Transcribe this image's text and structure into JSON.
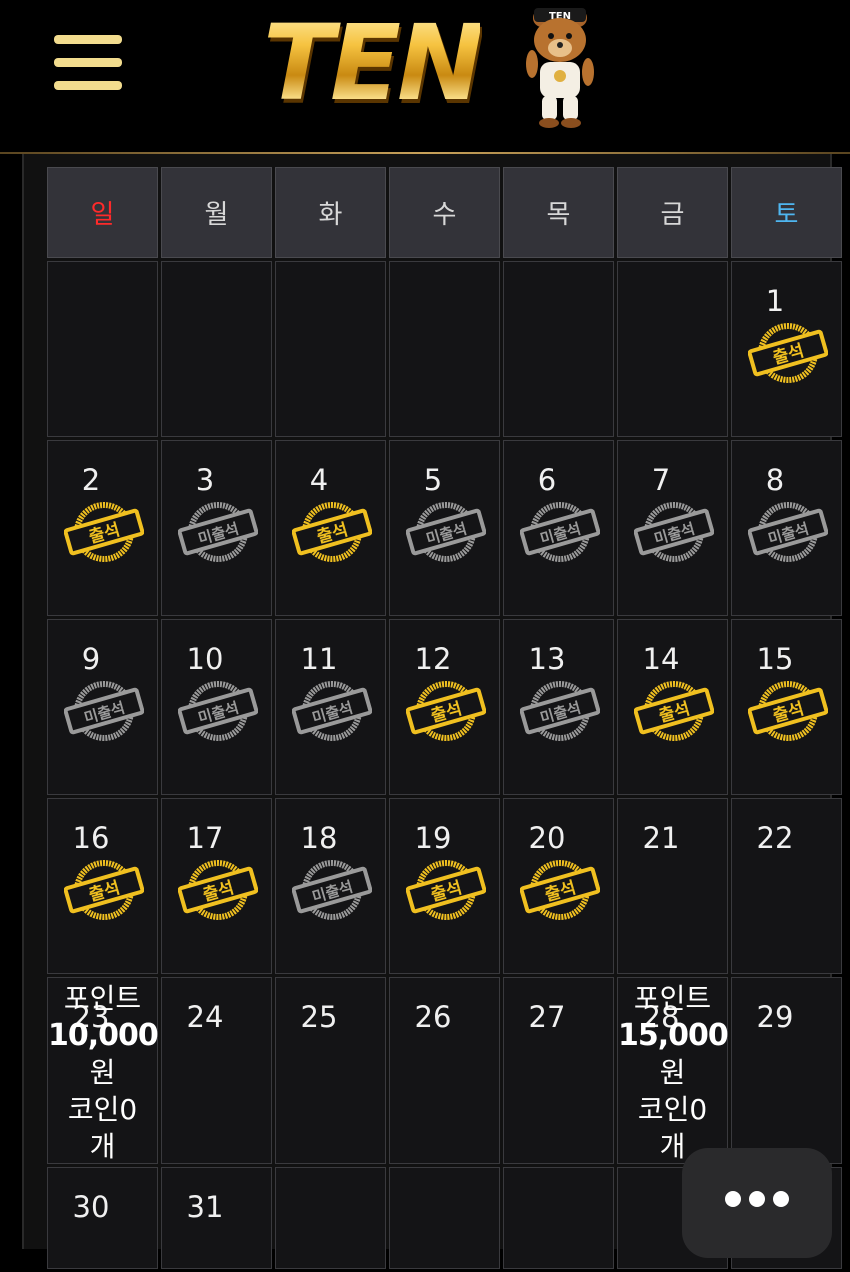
{
  "header": {
    "menu_icon": "hamburger-menu-icon",
    "logo_text": "TEN",
    "mascot_badge": "TEN"
  },
  "calendar": {
    "weekdays": [
      "일",
      "월",
      "화",
      "수",
      "목",
      "금",
      "토"
    ],
    "colors": {
      "sunday": "#ff2a2a",
      "saturday": "#4fb6f0",
      "attended": "#f0c020",
      "absent": "#9a9a9a"
    },
    "stamp_attended_label": "출석",
    "stamp_absent_label": "미출석",
    "weeks": [
      [
        null,
        null,
        null,
        null,
        null,
        null,
        {
          "day": "1",
          "stamp": "attended"
        }
      ],
      [
        {
          "day": "2",
          "stamp": "attended"
        },
        {
          "day": "3",
          "stamp": "absent"
        },
        {
          "day": "4",
          "stamp": "attended"
        },
        {
          "day": "5",
          "stamp": "absent"
        },
        {
          "day": "6",
          "stamp": "absent"
        },
        {
          "day": "7",
          "stamp": "absent"
        },
        {
          "day": "8",
          "stamp": "absent"
        }
      ],
      [
        {
          "day": "9",
          "stamp": "absent"
        },
        {
          "day": "10",
          "stamp": "absent"
        },
        {
          "day": "11",
          "stamp": "absent"
        },
        {
          "day": "12",
          "stamp": "attended"
        },
        {
          "day": "13",
          "stamp": "absent"
        },
        {
          "day": "14",
          "stamp": "attended"
        },
        {
          "day": "15",
          "stamp": "attended"
        }
      ],
      [
        {
          "day": "16",
          "stamp": "attended"
        },
        {
          "day": "17",
          "stamp": "attended"
        },
        {
          "day": "18",
          "stamp": "absent"
        },
        {
          "day": "19",
          "stamp": "attended"
        },
        {
          "day": "20",
          "stamp": "attended"
        },
        {
          "day": "21",
          "stamp": null
        },
        {
          "day": "22",
          "stamp": null
        }
      ],
      [
        {
          "day": "23",
          "stamp": null,
          "reward": {
            "line1": "포인트",
            "amount": "10,000",
            "unit": "원",
            "coin": "코인0",
            "coin_unit": "개"
          }
        },
        {
          "day": "24",
          "stamp": null
        },
        {
          "day": "25",
          "stamp": null
        },
        {
          "day": "26",
          "stamp": null
        },
        {
          "day": "27",
          "stamp": null
        },
        {
          "day": "28",
          "stamp": null,
          "reward": {
            "line1": "포인트",
            "amount": "15,000",
            "unit": "원",
            "coin": "코인0",
            "coin_unit": "개"
          }
        },
        {
          "day": "29",
          "stamp": null
        }
      ],
      [
        {
          "day": "30",
          "stamp": null
        },
        {
          "day": "31",
          "stamp": null
        },
        null,
        null,
        null,
        null,
        null
      ]
    ]
  },
  "floating": {
    "more_icon": "more-dots-icon"
  }
}
